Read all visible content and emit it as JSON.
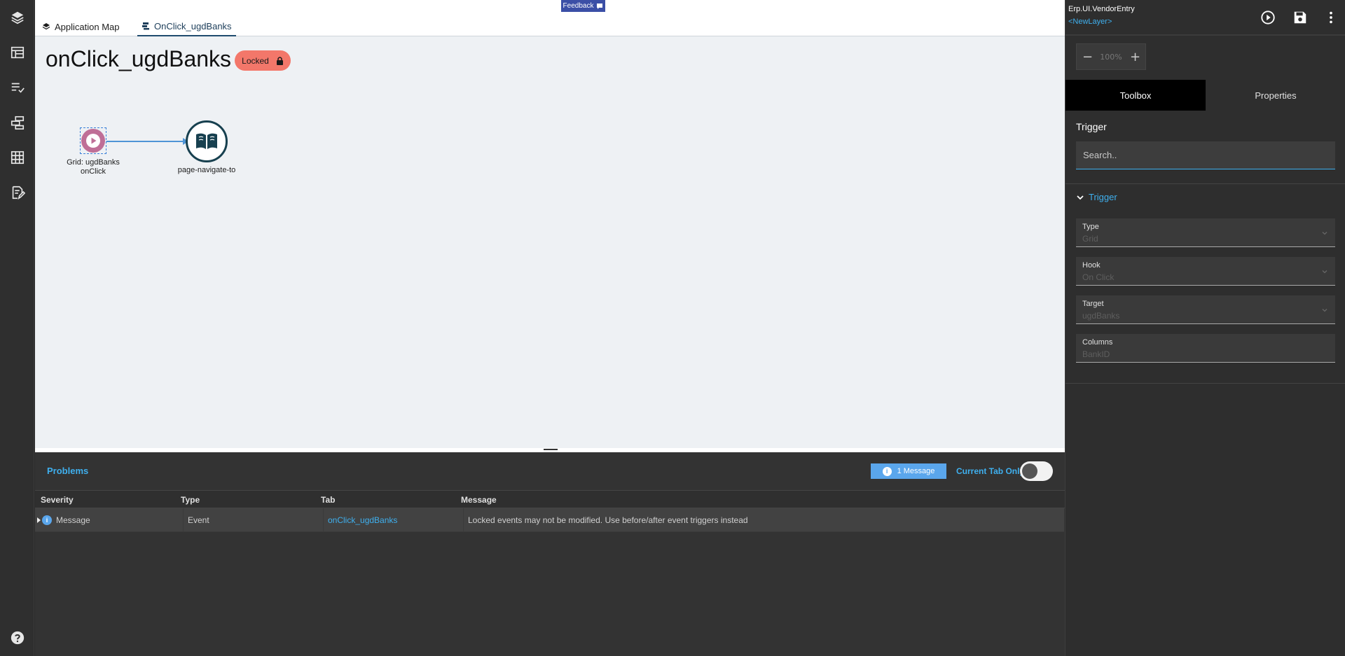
{
  "tabs": [
    {
      "label": "Application Map",
      "icon": "layers-icon"
    },
    {
      "label": "OnClick_ugdBanks",
      "icon": "event-icon"
    }
  ],
  "feedback": {
    "label": "Feedback",
    "icon": "comment-icon"
  },
  "canvas": {
    "title": "onClick_ugdBanks",
    "locked_label": "Locked",
    "trigger_node": {
      "label_line1": "Grid: ugdBanks",
      "label_line2": "onClick",
      "icon": "play-icon"
    },
    "action_node": {
      "label": "page-navigate-to",
      "icon": "book-icon"
    }
  },
  "problems": {
    "title": "Problems",
    "message_count": "1 Message",
    "current_tab_only": "Current Tab Only",
    "current_tab_only_on": false,
    "columns": [
      "Severity",
      "Type",
      "Tab",
      "Message"
    ],
    "rows": [
      {
        "severity": "Message",
        "type": "Event",
        "tab": "onClick_ugdBanks",
        "message": "Locked events may not be modified. Use before/after event triggers instead"
      }
    ]
  },
  "sidebar": {
    "app_name": "Erp.UI.VendorEntry",
    "layer": "<NewLayer>",
    "zoom": {
      "value": "100%",
      "minus": "−",
      "plus": "+"
    },
    "tabs": [
      "Toolbox",
      "Properties"
    ],
    "active_tab": "Toolbox",
    "section_title": "Trigger",
    "search_placeholder": "Search..",
    "group_label": "Trigger",
    "fields": [
      {
        "label": "Type",
        "value": "Grid",
        "dropdown": true
      },
      {
        "label": "Hook",
        "value": "On Click",
        "dropdown": true
      },
      {
        "label": "Target",
        "value": "ugdBanks",
        "dropdown": true
      },
      {
        "label": "Columns",
        "value": "BankID",
        "dropdown": false
      }
    ]
  },
  "colors": {
    "accent": "#3fb0ef",
    "locked": "#f3776a",
    "trigger": "#bf6f97",
    "action_border": "#17404f",
    "feedback": "#3b4fa6"
  }
}
